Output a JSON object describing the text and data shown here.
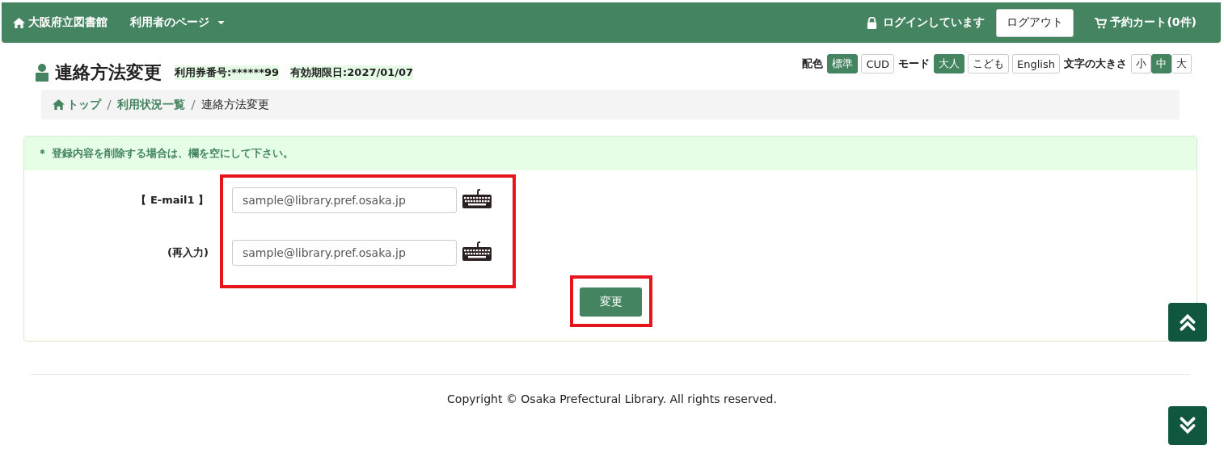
{
  "navbar": {
    "brand": "大阪府立図書館",
    "menu": "利用者のページ",
    "login_status": "ログインしています",
    "logout": "ログアウト",
    "cart": "予約カート(0件)"
  },
  "header": {
    "title": "連絡方法変更",
    "card_number": "利用券番号:******99",
    "expiry": "有効期限日:2027/01/07"
  },
  "settings": [
    {
      "label": "配色",
      "options": [
        {
          "label": "標準",
          "selected": true
        },
        {
          "label": "CUD",
          "selected": false
        }
      ]
    },
    {
      "label": "モード",
      "options": [
        {
          "label": "大人",
          "selected": true
        },
        {
          "label": "こども",
          "selected": false
        },
        {
          "label": "English",
          "selected": false
        }
      ]
    },
    {
      "label": "文字の大きさ",
      "options": [
        {
          "label": "小",
          "selected": false
        },
        {
          "label": "中",
          "selected": true
        },
        {
          "label": "大",
          "selected": false
        }
      ],
      "joined": true
    }
  ],
  "breadcrumb": [
    {
      "label": "トップ",
      "link": true
    },
    {
      "label": "利用状況一覧",
      "link": true
    },
    {
      "label": "連絡方法変更",
      "link": false
    }
  ],
  "notice": "＊ 登録内容を削除する場合は、欄を空にして下さい。",
  "fields": [
    {
      "label": "【 E-mail1 】",
      "value": "sample@library.pref.osaka.jp"
    },
    {
      "label": "(再入力)",
      "value": "sample@library.pref.osaka.jp"
    }
  ],
  "submit": "変更",
  "footer": "Copyright © Osaka Prefectural Library. All rights reserved."
}
